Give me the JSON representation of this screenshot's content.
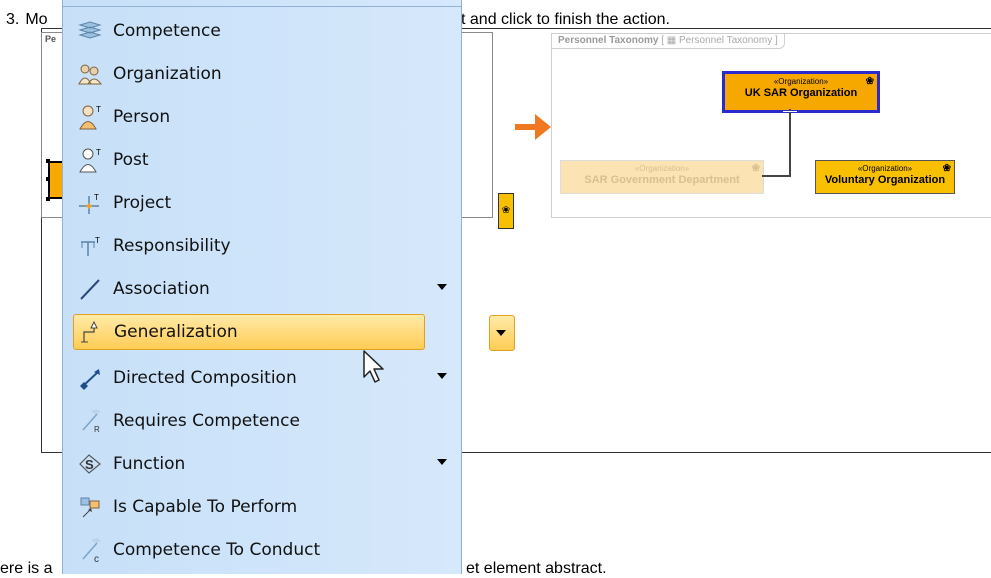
{
  "instructions": {
    "step_number": "3.",
    "step_start": "Mo",
    "step_end": "t and click to finish the action.",
    "bottom_start": "ere is a",
    "bottom_end": "et element abstract."
  },
  "left_diagram": {
    "tab_label": "Pe"
  },
  "right_diagram": {
    "tab_title": "Personnel Taxonomy",
    "tab_bracket_open": "[",
    "tab_ref": "Personnel Taxonomy",
    "tab_bracket_close": "]",
    "elements": [
      {
        "stereotype": "«Organization»",
        "name": "UK SAR Organization"
      },
      {
        "stereotype": "«Organization»",
        "name": "SAR Government Department"
      },
      {
        "stereotype": "«Organization»",
        "name": "Voluntary Organization"
      }
    ]
  },
  "menu": {
    "items": [
      {
        "label": "Competence",
        "icon": "competence-icon"
      },
      {
        "label": "Organization",
        "icon": "organization-icon"
      },
      {
        "label": "Person",
        "icon": "person-icon"
      },
      {
        "label": "Post",
        "icon": "post-icon"
      },
      {
        "label": "Project",
        "icon": "project-icon"
      },
      {
        "label": "Responsibility",
        "icon": "responsibility-icon"
      },
      {
        "label": "Association",
        "icon": "association-icon"
      },
      {
        "label": "Generalization",
        "icon": "generalization-icon"
      },
      {
        "label": "Directed Composition",
        "icon": "directed-composition-icon"
      },
      {
        "label": "Requires Competence",
        "icon": "requires-competence-icon"
      },
      {
        "label": "Function",
        "icon": "function-icon"
      },
      {
        "label": "Is Capable To Perform",
        "icon": "is-capable-to-perform-icon"
      },
      {
        "label": "Competence To Conduct",
        "icon": "competence-to-conduct-icon"
      }
    ]
  },
  "colors": {
    "menu_bg": "#c7e0f8",
    "selected_bg": "#ffcc55",
    "element_fill": "#f6a800",
    "selection_border": "#2a2acf",
    "arrow": "#f07820"
  }
}
